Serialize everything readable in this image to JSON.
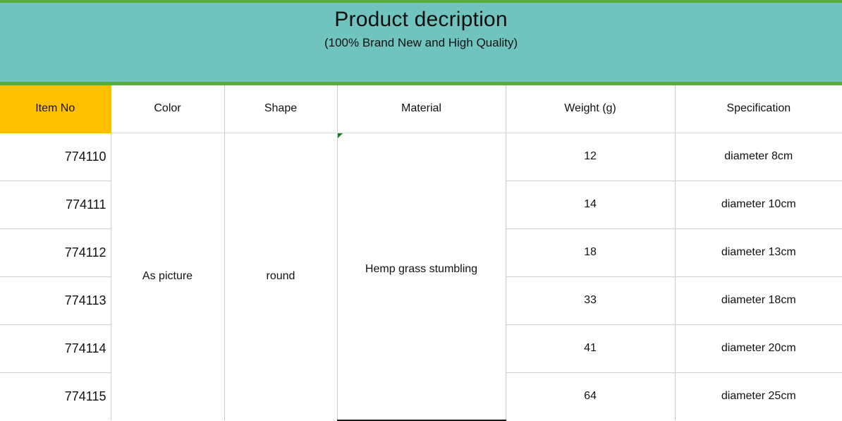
{
  "banner": {
    "title": "Product decription",
    "subtitle": "(100% Brand New and High Quality)",
    "background_color": "#71C4BE",
    "border_color": "#5BA83C"
  },
  "table": {
    "header_accent_color": "#FFC000",
    "columns": [
      {
        "key": "item_no",
        "label": "Item No"
      },
      {
        "key": "color",
        "label": "Color"
      },
      {
        "key": "shape",
        "label": "Shape"
      },
      {
        "key": "material",
        "label": "Material"
      },
      {
        "key": "weight",
        "label": "Weight (g)"
      },
      {
        "key": "specification",
        "label": "Specification"
      }
    ],
    "merged": {
      "color": "As picture",
      "shape": "round",
      "material": "Hemp grass stumbling"
    },
    "rows": [
      {
        "item_no": "774110",
        "weight": "12",
        "specification": "diameter 8cm"
      },
      {
        "item_no": "774111",
        "weight": "14",
        "specification": "diameter 10cm"
      },
      {
        "item_no": "774112",
        "weight": "18",
        "specification": "diameter 13cm"
      },
      {
        "item_no": "774113",
        "weight": "33",
        "specification": "diameter 18cm"
      },
      {
        "item_no": "774114",
        "weight": "41",
        "specification": "diameter 20cm"
      },
      {
        "item_no": "774115",
        "weight": "64",
        "specification": "diameter 25cm"
      }
    ]
  }
}
